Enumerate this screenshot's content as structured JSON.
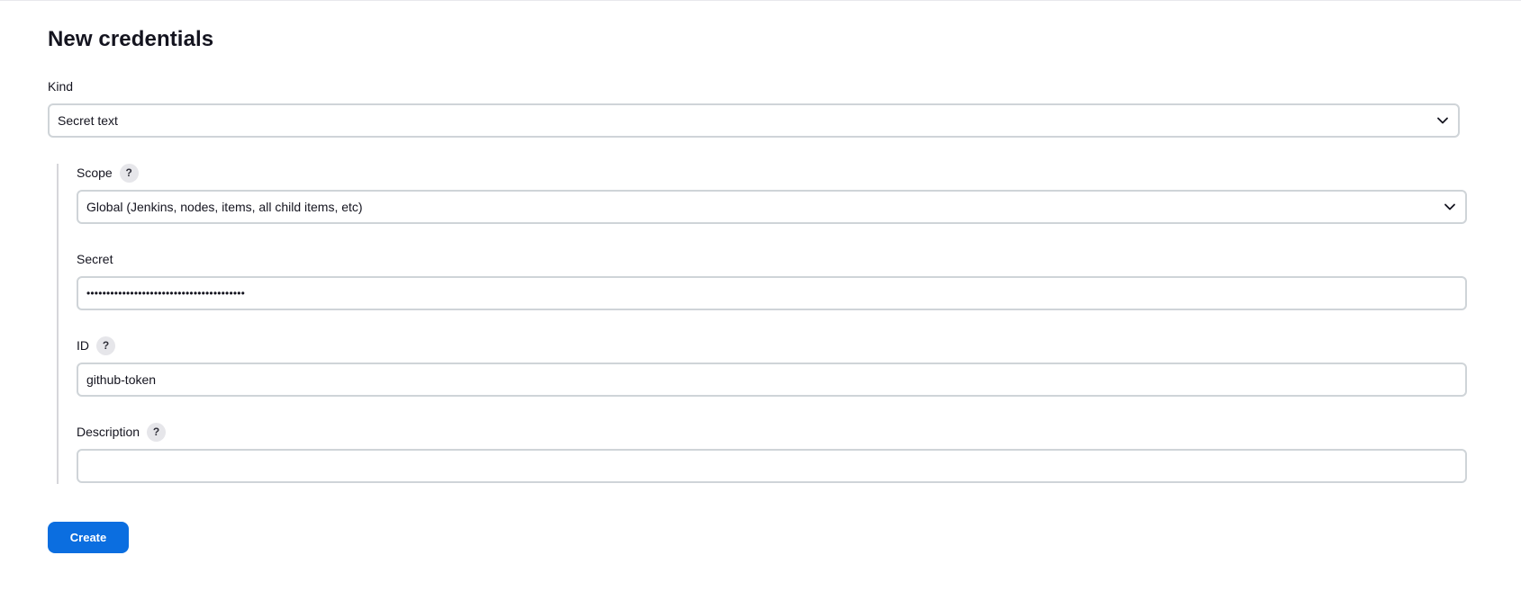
{
  "page": {
    "title": "New credentials"
  },
  "kind": {
    "label": "Kind",
    "selected": "Secret text"
  },
  "scope": {
    "label": "Scope",
    "help": "?",
    "selected": "Global (Jenkins, nodes, items, all child items, etc)"
  },
  "secret": {
    "label": "Secret",
    "value": "••••••••••••••••••••••••••••••••••••••••"
  },
  "id_field": {
    "label": "ID",
    "help": "?",
    "value": "github-token"
  },
  "description": {
    "label": "Description",
    "help": "?",
    "value": ""
  },
  "actions": {
    "create_label": "Create"
  },
  "colors": {
    "accent": "#0b6ee0",
    "border": "#cfd4d8",
    "help_bg": "#e6e6ea"
  }
}
